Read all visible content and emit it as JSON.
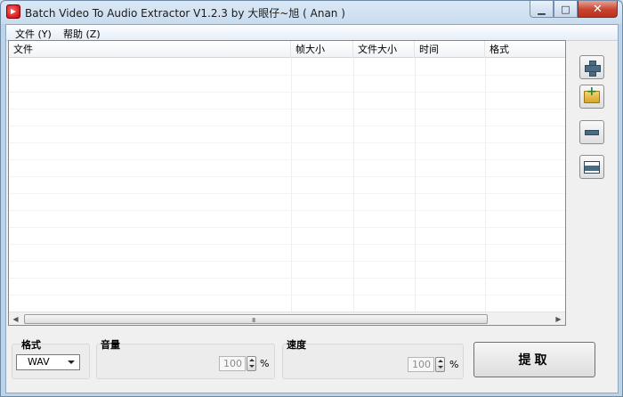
{
  "window": {
    "title": "Batch Video To Audio Extractor V1.2.3 by 大眼仔~旭 ( Anan )",
    "minimize_glyph": "▁",
    "maximize_glyph": "□",
    "close_glyph": "✕"
  },
  "menu": [
    {
      "label": "文件 (Y)"
    },
    {
      "label": "帮助 (Z)"
    }
  ],
  "file_list": {
    "columns": [
      "文件",
      "帧大小",
      "文件大小",
      "时间",
      "格式"
    ],
    "rows": [],
    "scroll_grip": "III"
  },
  "side_buttons": [
    {
      "name": "add-files",
      "icon": "plus-icon"
    },
    {
      "name": "add-folder",
      "icon": "folder-add-icon"
    },
    {
      "name": "remove",
      "icon": "minus-icon"
    },
    {
      "name": "clear-all",
      "icon": "clear-list-icon"
    }
  ],
  "format": {
    "label": "格式",
    "selected": "WAV"
  },
  "volume": {
    "label": "音量",
    "value": "100",
    "unit": "%"
  },
  "speed": {
    "label": "速度",
    "value": "100",
    "unit": "%"
  },
  "extract_button": {
    "label": "提取"
  },
  "colors": {
    "title_bar": "#c8dcee",
    "close_button": "#c8432e",
    "icon_blue": "#4a6b82"
  }
}
